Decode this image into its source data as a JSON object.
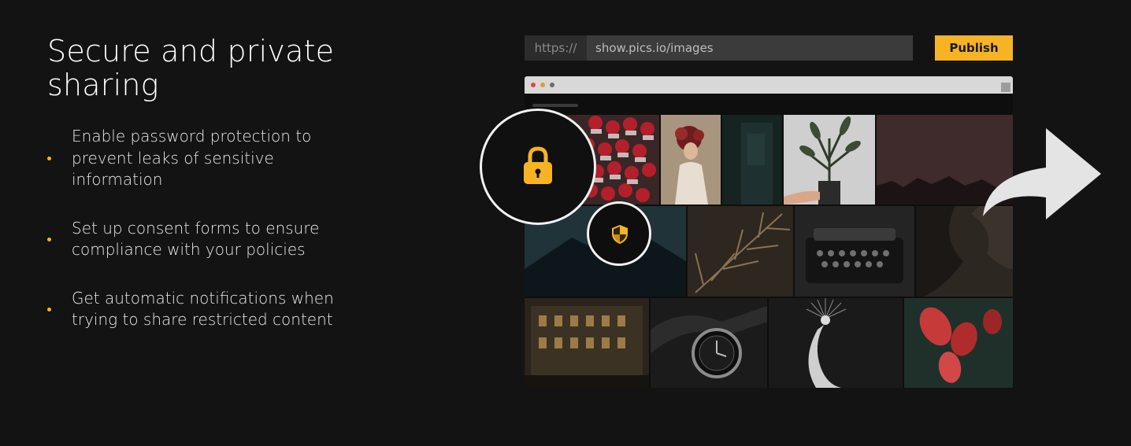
{
  "headline": "Secure and private sharing",
  "bullets": [
    "Enable password protection to prevent leaks of sensitive information",
    "Set up consent forms to ensure compliance with your policies",
    "Get automatic notifications when trying to share restricted content"
  ],
  "url_bar": {
    "prefix": "https://",
    "value": "show.pics.io/images"
  },
  "publish_button": "Publish",
  "icons": {
    "bullet": "bullet-dot-icon",
    "lock": "lock-icon",
    "shield": "shield-icon",
    "share": "share-arrow-icon"
  },
  "gallery_images": [
    "dessert-image",
    "woman-flowers-image",
    "dark-teal-image",
    "plant-hand-image",
    "dark-red-landscape-image",
    "mountain-image",
    "dried-leaves-image",
    "typewriter-image",
    "rock-texture-image",
    "building-night-image",
    "watch-image",
    "bird-image",
    "red-flowers-image"
  ],
  "colors": {
    "background": "#131313",
    "accent": "#f6b324",
    "text": "#ffffff"
  }
}
